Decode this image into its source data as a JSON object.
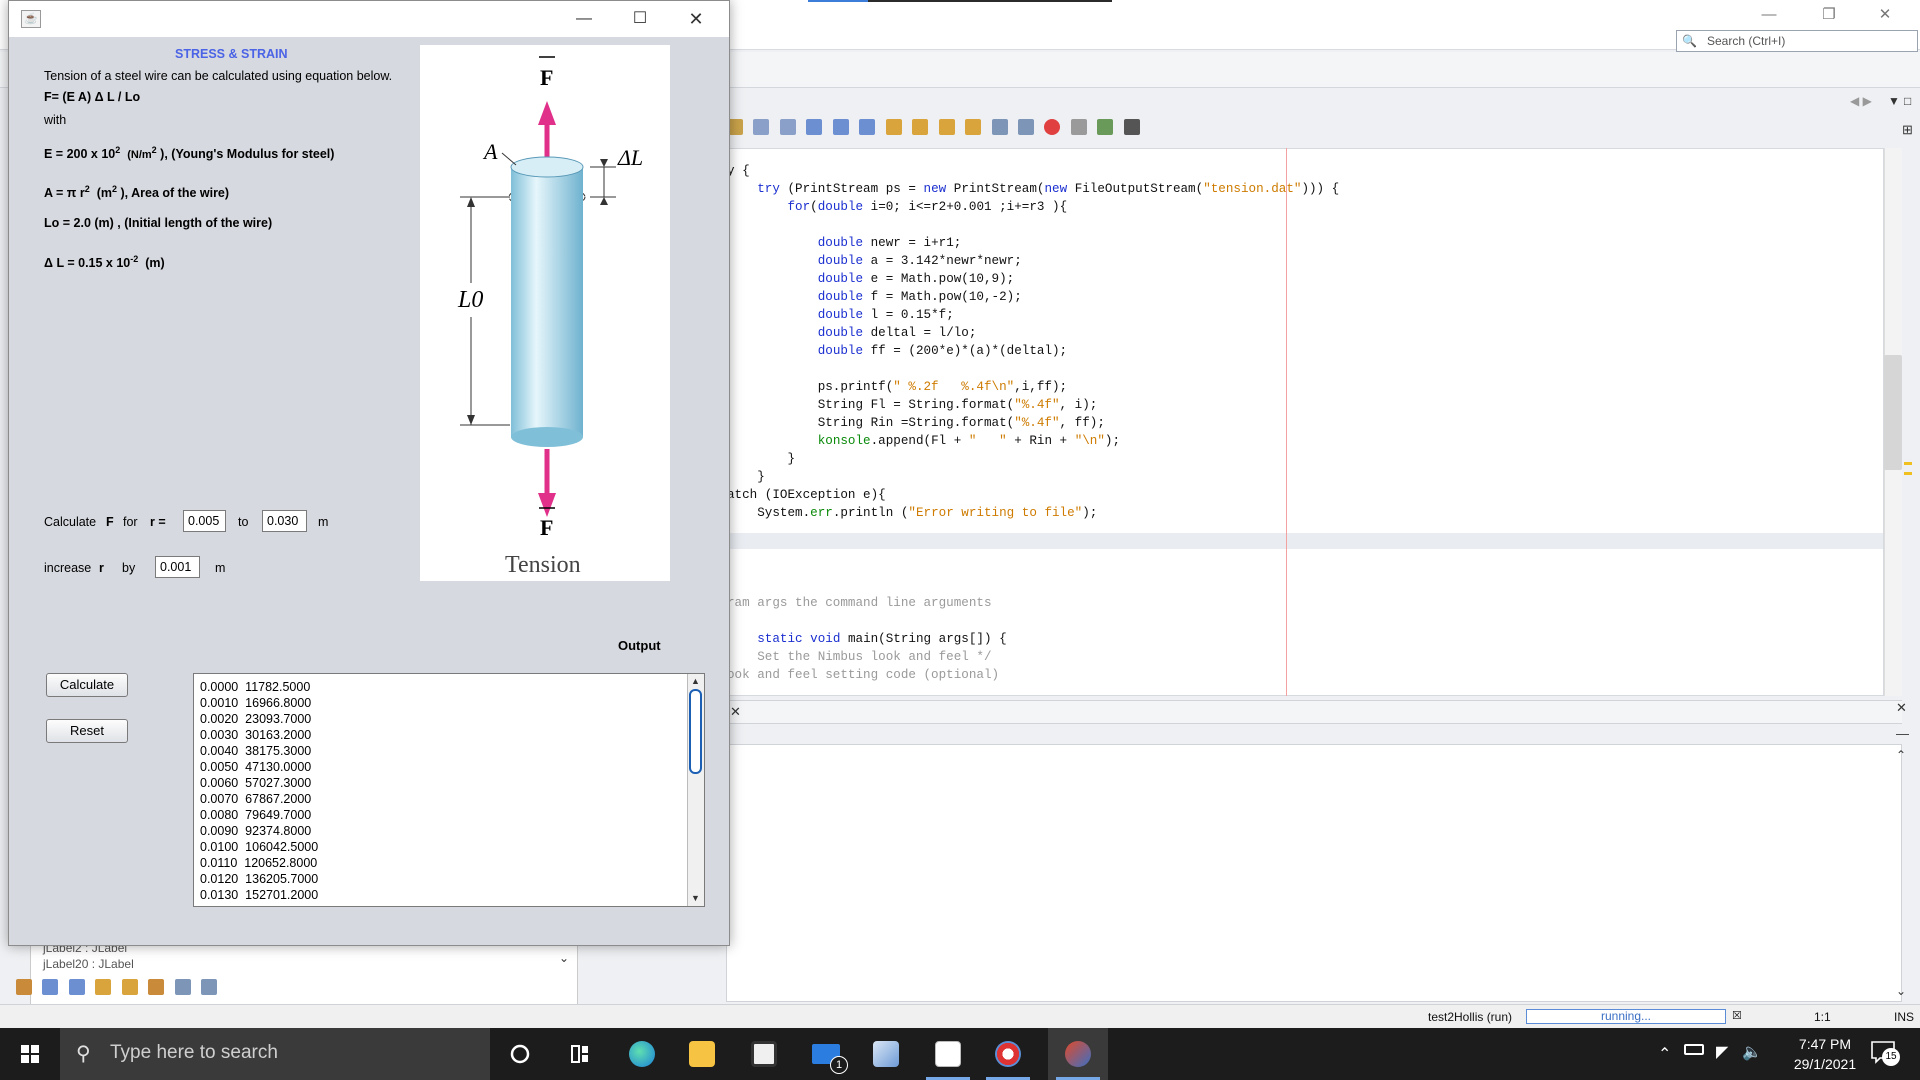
{
  "ide": {
    "search_placeholder": "Search (Ctrl+I)",
    "status": {
      "project_run": "test2Hollis (run)",
      "progress_text": "running...",
      "caret": "1:1",
      "mode": "INS"
    },
    "left_panel": {
      "item1": "jLabel2 : JLabel",
      "item2": "jLabel20 : JLabel"
    },
    "code_lines": [
      {
        "t": "y {"
      },
      {
        "t": "    try (PrintStream ps = new PrintStream(new FileOutputStream(\"tension.dat\"))) {"
      },
      {
        "t": "        for(double i=0; i<=r2+0.001 ;i+=r3 ){"
      },
      {
        "t": ""
      },
      {
        "t": "            double newr = i+r1;"
      },
      {
        "t": "            double a = 3.142*newr*newr;"
      },
      {
        "t": "            double e = Math.pow(10,9);"
      },
      {
        "t": "            double f = Math.pow(10,-2);"
      },
      {
        "t": "            double l = 0.15*f;"
      },
      {
        "t": "            double deltal = l/lo;"
      },
      {
        "t": "            double ff = (200*e)*(a)*(deltal);"
      },
      {
        "t": ""
      },
      {
        "t": "            ps.printf(\" %.2f   %.4f\\n\",i,ff);"
      },
      {
        "t": "            String Fl = String.format(\"%.4f\", i);"
      },
      {
        "t": "            String Rin =String.format(\"%.4f\", ff);"
      },
      {
        "t": "            konsole.append(Fl + \"   \" + Rin + \"\\n\");"
      },
      {
        "t": "        }"
      },
      {
        "t": "    }"
      },
      {
        "t": "atch (IOException e){"
      },
      {
        "t": "    System.err.println (\"Error writing to file\");"
      },
      {
        "t": ""
      },
      {
        "t": ""
      },
      {
        "t": ""
      },
      {
        "t": ""
      },
      {
        "t": "ram args the command line arguments"
      },
      {
        "t": ""
      },
      {
        "t": "    static void main(String args[]) {"
      },
      {
        "t": "    Set the Nimbus look and feel */"
      },
      {
        "t": "ook and feel setting code (optional)"
      }
    ]
  },
  "taskbar": {
    "search_placeholder": "Type here to search",
    "time": "7:47 PM",
    "date": "29/1/2021",
    "notification_count": "15",
    "mail_badge": "1"
  },
  "app": {
    "heading": "STRESS & STRAIN",
    "intro": "Tension of a steel wire can be calculated using equation below.",
    "equation": "F= (E A) Δ L / Lo",
    "with": "with",
    "e_def_prefix": "E = 200 x 10",
    "e_def_exp": "2",
    "e_def_unit_prefix": "(N/m",
    "e_def_unit_exp": "2",
    "e_def_suffix": "), (Young's Modulus for steel)",
    "a_def_prefix": "A = π r",
    "a_def_exp": "2",
    "a_def_unit_prefix": "(m",
    "a_def_unit_exp": "2",
    "a_def_suffix": "), Area of the wire)",
    "lo_def": "Lo = 2.0 (m) , (Initial length of the wire)",
    "dl_def_prefix": "Δ L = 0.15 x 10",
    "dl_def_exp": "-2",
    "dl_def_suffix": "(m)",
    "figure": {
      "force_top": "F",
      "force_bottom": "F",
      "area_label": "A",
      "delta_l_label": "ΔL",
      "length_label": "L0",
      "caption": "Tension"
    },
    "calc_label_1": "Calculate",
    "calc_label_F": "F",
    "calc_label_for": "for",
    "calc_label_r": "r =",
    "r_from": "0.005",
    "to_label": "to",
    "r_to": "0.030",
    "unit_m": "m",
    "increase_label": "increase",
    "increase_r": "r",
    "by_label": "by",
    "r_step": "0.001",
    "unit_m2": "m",
    "output_label": "Output",
    "calculate_button": "Calculate",
    "reset_button": "Reset",
    "output_rows": [
      "0.0000  11782.5000",
      "0.0010  16966.8000",
      "0.0020  23093.7000",
      "0.0030  30163.2000",
      "0.0040  38175.3000",
      "0.0050  47130.0000",
      "0.0060  57027.3000",
      "0.0070  67867.2000",
      "0.0080  79649.7000",
      "0.0090  92374.8000",
      "0.0100  106042.5000",
      "0.0110  120652.8000",
      "0.0120  136205.7000",
      "0.0130  152701.2000"
    ]
  },
  "colors": {
    "heading": "#4b63e6",
    "arrow": "#e0308a",
    "cylinder": "#a9d9ea",
    "taskbar": "#1c1c1c"
  }
}
